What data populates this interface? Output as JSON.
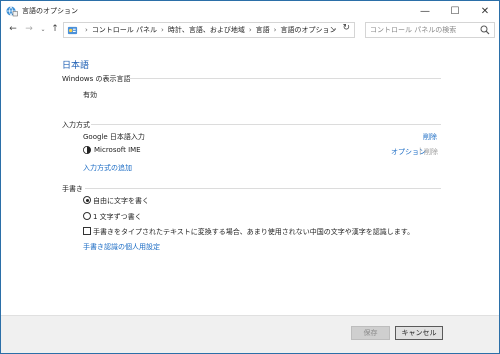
{
  "window": {
    "title": "言語のオプション",
    "minimize": "—",
    "maximize": "☐",
    "close": "✕"
  },
  "nav": {
    "back": "←",
    "forward": "→",
    "recent": "⌄",
    "up": "↑"
  },
  "address": {
    "crumbs": [
      "コントロール パネル",
      "時計、言語、および地域",
      "言語",
      "言語のオプション"
    ],
    "dropdown": "⌄",
    "refresh": "↻"
  },
  "search": {
    "placeholder": "コントロール パネルの検索"
  },
  "page": {
    "title": "日本語"
  },
  "display_language": {
    "label": "Windows の表示言語",
    "status": "有効"
  },
  "input_methods": {
    "label": "入力方式",
    "items": [
      {
        "name": "Google 日本語入力",
        "remove": "削除"
      },
      {
        "name": "Microsoft IME",
        "options": "オプション",
        "remove": "削除"
      }
    ],
    "add_link": "入力方式の追加"
  },
  "handwriting": {
    "label": "手書き",
    "options": [
      {
        "label": "自由に文字を書く",
        "checked": true
      },
      {
        "label": "1 文字ずつ書く",
        "checked": false
      }
    ],
    "checkbox_label": "手書きをタイプされたテキストに変換する場合、あまり使用されない中国の文字や漢字を認識します。",
    "checkbox_checked": false,
    "personalize_link": "手書き認識の個人用設定"
  },
  "footer": {
    "save": "保存",
    "cancel": "キャンセル"
  },
  "colors": {
    "accent": "#1a6bc4",
    "title_blue": "#1e5fb4",
    "disabled": "#9a9a9a"
  }
}
